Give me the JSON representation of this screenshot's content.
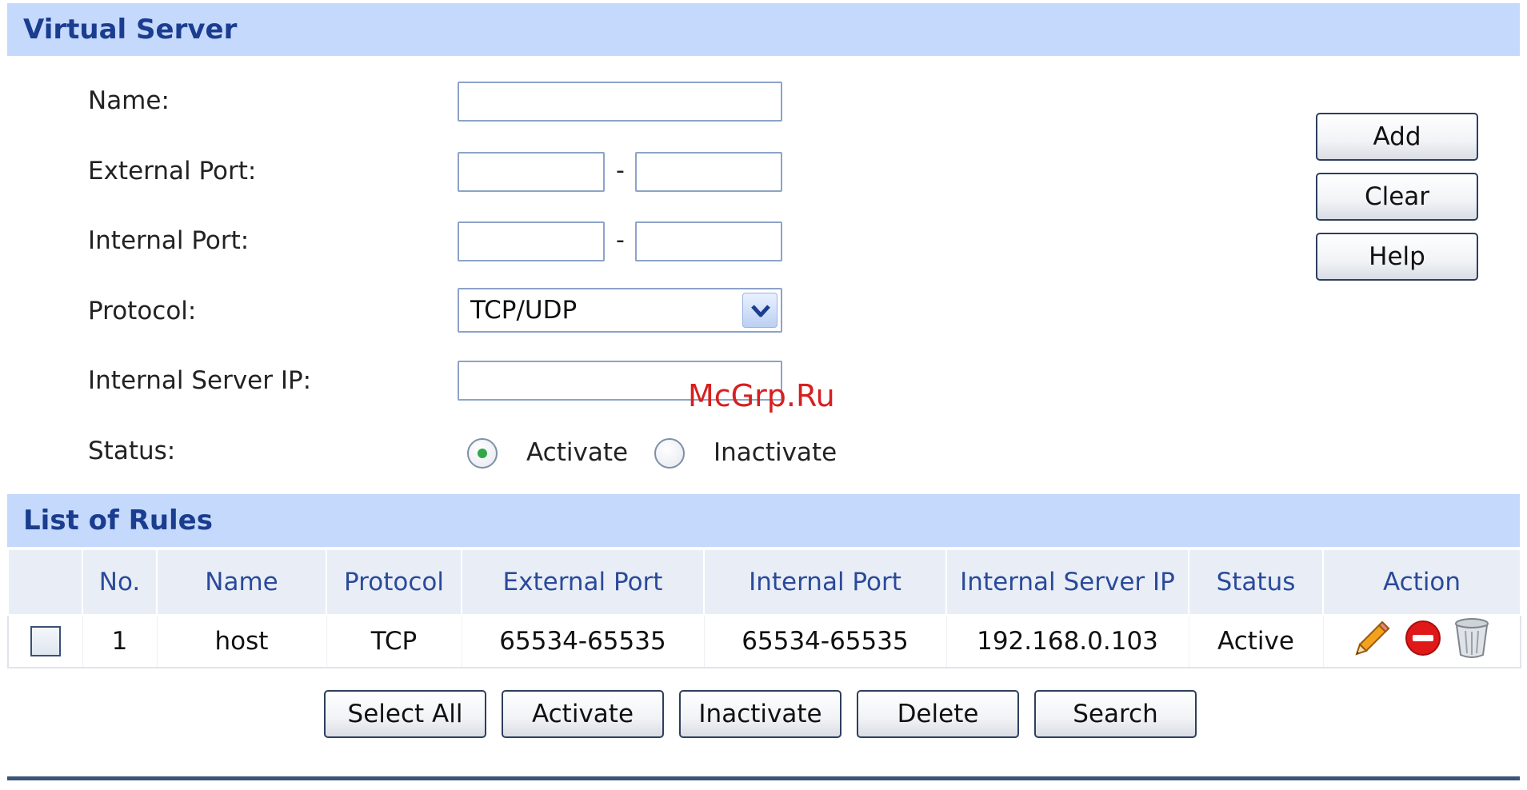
{
  "virtual_server": {
    "title": "Virtual Server",
    "labels": {
      "name": "Name:",
      "external_port": "External Port:",
      "internal_port": "Internal Port:",
      "protocol": "Protocol:",
      "internal_server_ip": "Internal Server IP:",
      "status": "Status:"
    },
    "fields": {
      "name": "",
      "external_port_from": "",
      "external_port_to": "",
      "internal_port_from": "",
      "internal_port_to": "",
      "internal_server_ip": ""
    },
    "port_separator": "-",
    "protocol_selected": "TCP/UDP",
    "status_options": {
      "activate": "Activate",
      "inactivate": "Inactivate"
    },
    "status_selected": "Activate",
    "buttons": {
      "add": "Add",
      "clear": "Clear",
      "help": "Help"
    }
  },
  "watermark": "McGrp.Ru",
  "list_of_rules": {
    "title": "List of Rules",
    "columns": {
      "no": "No.",
      "name": "Name",
      "protocol": "Protocol",
      "external_port": "External Port",
      "internal_port": "Internal Port",
      "internal_server_ip": "Internal Server IP",
      "status": "Status",
      "action": "Action"
    },
    "rows": [
      {
        "no": "1",
        "name": "host",
        "protocol": "TCP",
        "external_port": "65534-65535",
        "internal_port": "65534-65535",
        "internal_server_ip": "192.168.0.103",
        "status": "Active",
        "actions": [
          "pencil-icon",
          "stop-icon",
          "trash-icon"
        ]
      }
    ]
  },
  "bottom_buttons": {
    "select_all": "Select All",
    "activate": "Activate",
    "inactivate": "Inactivate",
    "delete": "Delete",
    "search": "Search"
  },
  "colors": {
    "section_bar": "#c5d9fc",
    "section_title": "#1b3d8f",
    "column_header": "#2a4a9a",
    "radio_selected": "#2fa84a",
    "delete_icon": "#e01818"
  }
}
